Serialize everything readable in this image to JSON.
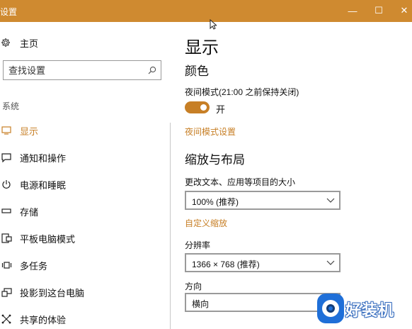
{
  "window": {
    "title": "设置",
    "minimize_glyph": "—",
    "maximize_glyph": "☐",
    "close_glyph": "✕",
    "accent_color": "#cf8a30"
  },
  "sidebar": {
    "home_label": "主页",
    "home_icon": "gear-icon",
    "search": {
      "placeholder": "查找设置",
      "icon": "search-icon"
    },
    "section_label": "系统",
    "items": [
      {
        "label": "显示",
        "icon": "monitor-icon",
        "active": true
      },
      {
        "label": "通知和操作",
        "icon": "message-icon",
        "active": false
      },
      {
        "label": "电源和睡眠",
        "icon": "power-icon",
        "active": false
      },
      {
        "label": "存储",
        "icon": "storage-icon",
        "active": false
      },
      {
        "label": "平板电脑模式",
        "icon": "tablet-icon",
        "active": false
      },
      {
        "label": "多任务",
        "icon": "multitask-icon",
        "active": false
      },
      {
        "label": "投影到这台电脑",
        "icon": "project-icon",
        "active": false
      },
      {
        "label": "共享的体验",
        "icon": "share-icon",
        "active": false
      }
    ],
    "active_color": "#c77f26"
  },
  "main": {
    "title": "显示",
    "color_section": {
      "heading": "颜色",
      "night_mode_label": "夜间模式(21:00 之前保持关闭)",
      "toggle_state": "开",
      "toggle_on": true,
      "night_mode_settings_link": "夜间模式设置"
    },
    "scale_section": {
      "heading": "缩放与布局",
      "text_size_label": "更改文本、应用等项目的大小",
      "scale_value": "100% (推荐)",
      "custom_scale_link": "自定义缩放",
      "resolution_label": "分辨率",
      "resolution_value": "1366 × 768 (推荐)",
      "orientation_label": "方向",
      "orientation_value": "横向"
    }
  },
  "watermark": {
    "text": "好装机",
    "logo_color": "#1f6fd8"
  }
}
